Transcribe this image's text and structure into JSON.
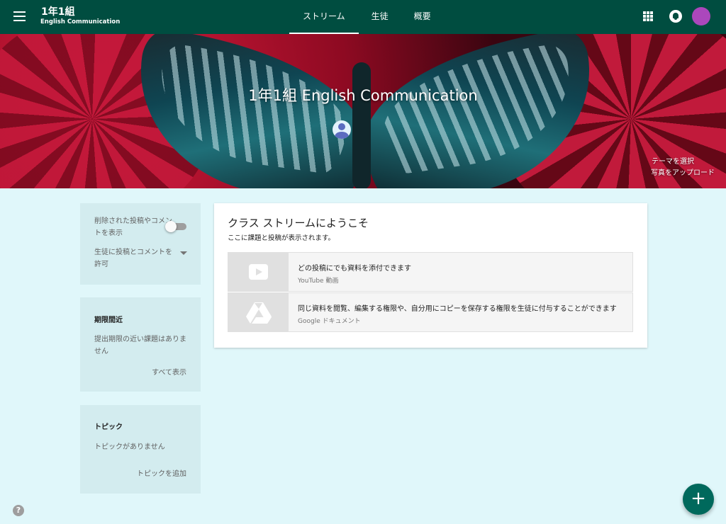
{
  "header": {
    "class_name": "1年1組",
    "class_subject": "English Communication",
    "tabs": [
      {
        "label": "ストリーム",
        "active": true
      },
      {
        "label": "生徒",
        "active": false
      },
      {
        "label": "概要",
        "active": false
      }
    ],
    "icons": [
      "menu-icon",
      "apps-icon",
      "notifications-icon",
      "account-avatar"
    ],
    "colors": {
      "app_bar": "#004d40",
      "avatar": "#ab47bc"
    }
  },
  "banner": {
    "title": "1年1組 English Communication",
    "select_theme": "テーマを選択",
    "upload_photo": "写真をアップロード"
  },
  "sidebar": {
    "settings": {
      "show_deleted_label": "削除された投稿やコメントを表示",
      "show_deleted_on": false,
      "student_permission_label": "生徒に投稿とコメントを許可"
    },
    "upcoming": {
      "heading": "期限間近",
      "empty_text": "提出期限の近い課題はありません",
      "view_all": "すべて表示"
    },
    "topics": {
      "heading": "トピック",
      "empty_text": "トピックがありません",
      "add_topic": "トピックを追加"
    }
  },
  "main": {
    "welcome_title": "クラス ストリームにようこそ",
    "welcome_subtitle": "ここに課題と投稿が表示されます。",
    "features": [
      {
        "icon": "youtube-icon",
        "title": "どの投稿にでも資料を添付できます",
        "subtitle": "YouTube 動画"
      },
      {
        "icon": "google-drive-icon",
        "title": "同じ資料を閲覧、編集する権限や、自分用にコピーを保存する権限を生徒に付与することができます",
        "subtitle": "Google ドキュメント"
      }
    ]
  },
  "fab": {
    "symbol": "+"
  },
  "help": {
    "symbol": "?"
  }
}
